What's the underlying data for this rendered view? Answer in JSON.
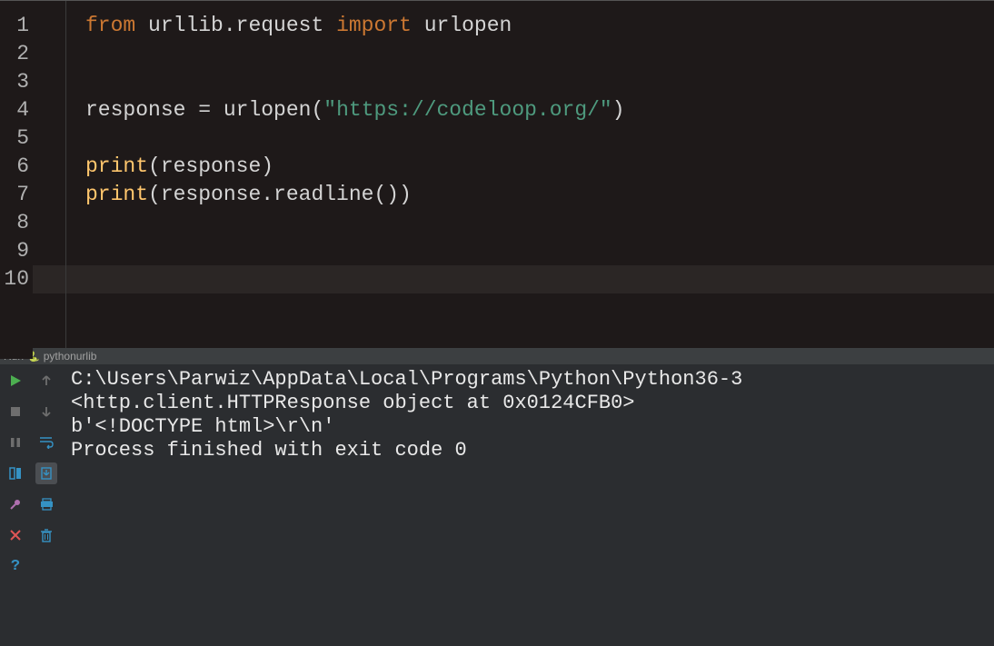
{
  "editor": {
    "line_numbers": [
      "1",
      "2",
      "3",
      "4",
      "5",
      "6",
      "7",
      "8",
      "9",
      "10"
    ],
    "tokens": {
      "l1_from": "from",
      "l1_mod": "urllib.request",
      "l1_import": "import",
      "l1_name": "urlopen",
      "l4_var": "response",
      "l4_eq": " = ",
      "l4_fn": "urlopen",
      "l4_lp": "(",
      "l4_str": "\"https://codeloop.org/\"",
      "l4_rp": ")",
      "l6_fn": "print",
      "l6_lp": "(",
      "l6_arg": "response",
      "l6_rp": ")",
      "l7_fn": "print",
      "l7_lp": "(",
      "l7_arg": "response.readline()",
      "l7_rp": ")"
    }
  },
  "run": {
    "label": "Run",
    "script": "pythonurlib",
    "output": {
      "line1": "C:\\Users\\Parwiz\\AppData\\Local\\Programs\\Python\\Python36-3",
      "line2": "<http.client.HTTPResponse object at 0x0124CFB0>",
      "line3": "b'<!DOCTYPE html>\\r\\n'",
      "blank": "",
      "exit": "Process finished with exit code 0"
    }
  }
}
